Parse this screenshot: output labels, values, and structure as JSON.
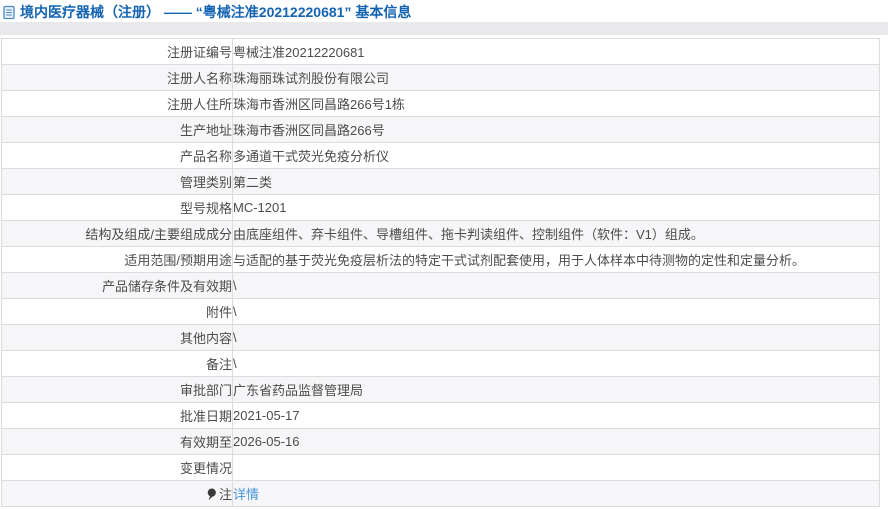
{
  "header": {
    "icon": "document-icon",
    "title": "境内医疗器械（注册） ——  “粤械注准20212220681”  基本信息"
  },
  "colors": {
    "title_blue": "#1464b3",
    "link_blue": "#4696d9",
    "row_alt_gray": "#f6f6f8",
    "band_gray": "#e9e9eb",
    "text_gray": "#4c4c4c"
  },
  "table": {
    "rows": [
      {
        "label": "注册证编号",
        "value": "粤械注准20212220681"
      },
      {
        "label": "注册人名称",
        "value": "珠海丽珠试剂股份有限公司"
      },
      {
        "label": "注册人住所",
        "value": "珠海市香洲区同昌路266号1栋"
      },
      {
        "label": "生产地址",
        "value": "珠海市香洲区同昌路266号"
      },
      {
        "label": "产品名称",
        "value": "多通道干式荧光免疫分析仪"
      },
      {
        "label": "管理类别",
        "value": "第二类"
      },
      {
        "label": "型号规格",
        "value": "MC-1201"
      },
      {
        "label": "结构及组成/主要组成成分",
        "value": "由底座组件、弃卡组件、导槽组件、拖卡判读组件、控制组件（软件：V1）组成。"
      },
      {
        "label": "适用范围/预期用途",
        "value": "与适配的基于荧光免疫层析法的特定干式试剂配套使用，用于人体样本中待测物的定性和定量分析。"
      },
      {
        "label": "产品储存条件及有效期",
        "value": "\\"
      },
      {
        "label": "附件",
        "value": "\\"
      },
      {
        "label": "其他内容",
        "value": "\\"
      },
      {
        "label": "备注",
        "value": "\\"
      },
      {
        "label": "审批部门",
        "value": "广东省药品监督管理局"
      },
      {
        "label": "批准日期",
        "value": "2021-05-17"
      },
      {
        "label": "有效期至",
        "value": "2026-05-16"
      },
      {
        "label": "变更情况",
        "value": ""
      },
      {
        "label": "注",
        "value": "详情",
        "link": true,
        "icon": "pin-icon"
      }
    ]
  }
}
